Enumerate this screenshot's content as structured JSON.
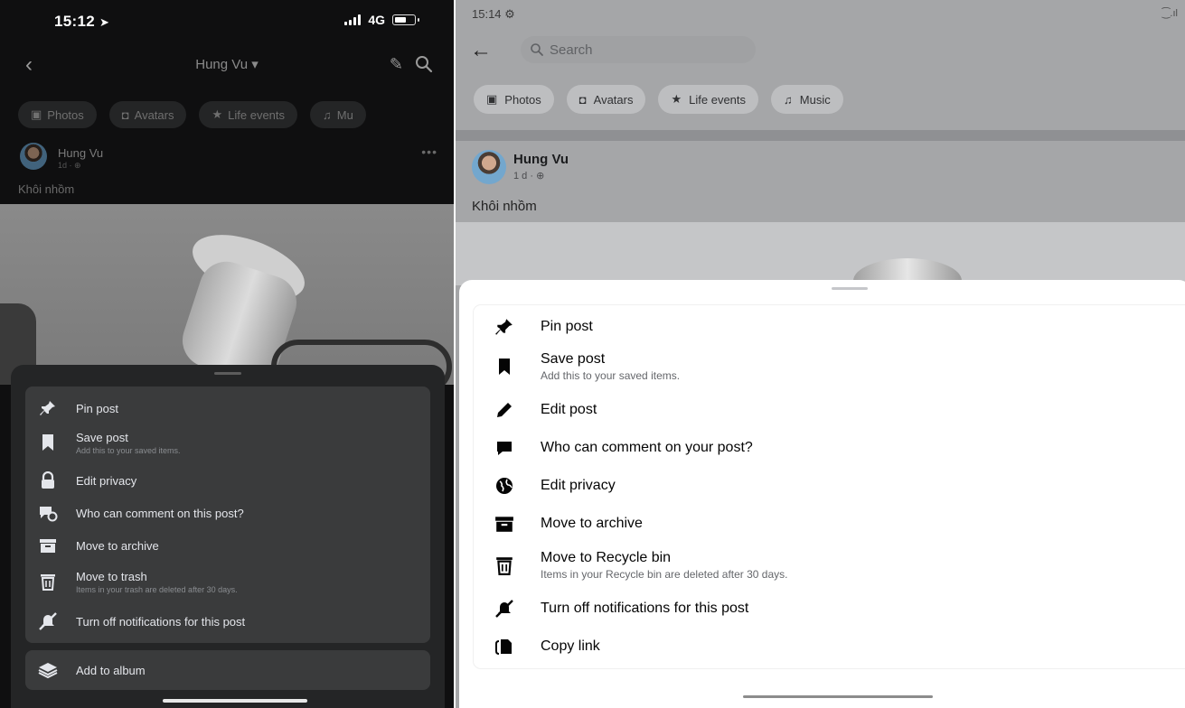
{
  "left": {
    "status": {
      "time": "15:12",
      "network": "4G"
    },
    "nav": {
      "title": "Hung Vu ▾"
    },
    "chips": [
      {
        "icon": "photos-icon",
        "label": "Photos"
      },
      {
        "icon": "avatars-icon",
        "label": "Avatars"
      },
      {
        "icon": "life-events-icon",
        "label": "Life events"
      },
      {
        "icon": "music-icon",
        "label": "Mu"
      }
    ],
    "post": {
      "author": "Hung Vu",
      "meta": "1d · ⊕",
      "caption": "Khôi nhồm"
    },
    "menu": [
      {
        "icon": "pin-icon",
        "label": "Pin post"
      },
      {
        "icon": "bookmark-icon",
        "label": "Save post",
        "sub": "Add this to your saved items."
      },
      {
        "icon": "lock-icon",
        "label": "Edit privacy"
      },
      {
        "icon": "comment-settings-icon",
        "label": "Who can comment on this post?"
      },
      {
        "icon": "archive-icon",
        "label": "Move to archive"
      },
      {
        "icon": "trash-icon",
        "label": "Move to trash",
        "sub": "Items in your trash are deleted after 30 days."
      },
      {
        "icon": "bell-off-icon",
        "label": "Turn off notifications for this post"
      }
    ],
    "extra": {
      "icon": "album-icon",
      "label": "Add to album"
    }
  },
  "right": {
    "status": {
      "time": "15:14",
      "signal": "⁐.ıl"
    },
    "search": {
      "placeholder": "Search"
    },
    "chips": [
      {
        "icon": "photos-icon",
        "label": "Photos"
      },
      {
        "icon": "avatars-icon",
        "label": "Avatars"
      },
      {
        "icon": "life-events-icon",
        "label": "Life events"
      },
      {
        "icon": "music-icon",
        "label": "Music"
      }
    ],
    "post": {
      "author": "Hung Vu",
      "meta": "1 d · ⊕",
      "caption": "Khôi nhồm"
    },
    "menu": [
      {
        "icon": "pin-icon",
        "label": "Pin post"
      },
      {
        "icon": "bookmark-icon",
        "label": "Save post",
        "sub": "Add this to your saved items."
      },
      {
        "icon": "pencil-icon",
        "label": "Edit post"
      },
      {
        "icon": "comment-icon",
        "label": "Who can comment on your post?"
      },
      {
        "icon": "globe-icon",
        "label": "Edit privacy"
      },
      {
        "icon": "archive-icon",
        "label": "Move to archive"
      },
      {
        "icon": "trash-icon",
        "label": "Move to Recycle bin",
        "sub": "Items in your Recycle bin are deleted after 30 days."
      },
      {
        "icon": "bell-off-icon",
        "label": "Turn off notifications for this post"
      },
      {
        "icon": "copy-link-icon",
        "label": "Copy link"
      }
    ]
  },
  "colors": {
    "dark_bg": "#0f0f10",
    "dark_sheet": "#242526",
    "dark_card": "#3a3b3c",
    "light_dim": "#a5a6a8",
    "light_sheet": "#ffffff"
  }
}
